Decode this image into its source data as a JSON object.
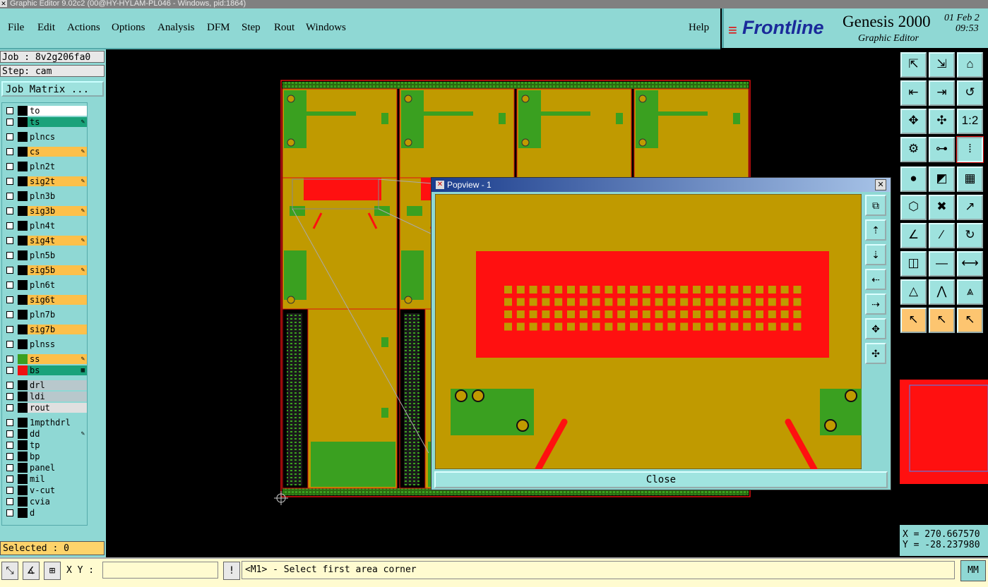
{
  "window_title": "Graphic Editor 9.02c2 (00@HY-HYLAM-PL046 - Windows, pid:1864)",
  "menu": {
    "file": "File",
    "edit": "Edit",
    "actions": "Actions",
    "options": "Options",
    "analysis": "Analysis",
    "dfm": "DFM",
    "step": "Step",
    "rout": "Rout",
    "windows": "Windows",
    "help": "Help"
  },
  "brand": {
    "logo": "Frontline",
    "product": "Genesis 2000",
    "subtitle": "Graphic Editor",
    "date": "01 Feb 2",
    "time": "09:53"
  },
  "job": {
    "job_line": "Job : 8v2g206fa0",
    "step_line": "Step: cam",
    "matrix_button": "Job Matrix ..."
  },
  "layers": [
    {
      "name": "to",
      "color": "#000000",
      "bg": "#ffffff",
      "mark": ""
    },
    {
      "name": "ts",
      "color": "#000000",
      "bg": "#1aa27a",
      "mark": "✎"
    },
    {
      "name": "plncs",
      "color": "#000000",
      "bg": "#8fd8d4",
      "mark": ""
    },
    {
      "name": "cs",
      "color": "#000000",
      "bg": "#fdc04a",
      "mark": "✎"
    },
    {
      "name": "pln2t",
      "color": "#000000",
      "bg": "#8fd8d4",
      "mark": ""
    },
    {
      "name": "sig2t",
      "color": "#000000",
      "bg": "#fdc04a",
      "mark": "✎"
    },
    {
      "name": "pln3b",
      "color": "#000000",
      "bg": "#8fd8d4",
      "mark": ""
    },
    {
      "name": "sig3b",
      "color": "#000000",
      "bg": "#fdc04a",
      "mark": "✎"
    },
    {
      "name": "pln4t",
      "color": "#000000",
      "bg": "#8fd8d4",
      "mark": ""
    },
    {
      "name": "sig4t",
      "color": "#000000",
      "bg": "#fdc04a",
      "mark": "✎"
    },
    {
      "name": "pln5b",
      "color": "#000000",
      "bg": "#8fd8d4",
      "mark": ""
    },
    {
      "name": "sig5b",
      "color": "#000000",
      "bg": "#fdc04a",
      "mark": "✎"
    },
    {
      "name": "pln6t",
      "color": "#000000",
      "bg": "#8fd8d4",
      "mark": ""
    },
    {
      "name": "sig6t",
      "color": "#000000",
      "bg": "#fdc04a",
      "mark": ""
    },
    {
      "name": "pln7b",
      "color": "#000000",
      "bg": "#8fd8d4",
      "mark": ""
    },
    {
      "name": "sig7b",
      "color": "#000000",
      "bg": "#fdc04a",
      "mark": ""
    },
    {
      "name": "plnss",
      "color": "#000000",
      "bg": "#8fd8d4",
      "mark": ""
    },
    {
      "name": "ss",
      "color": "#3aa020",
      "bg": "#fdc04a",
      "mark": "✎"
    },
    {
      "name": "bs",
      "color": "#ee1111",
      "bg": "#1aa27a",
      "mark": "▦"
    },
    {
      "name": "drl",
      "color": "#000000",
      "bg": "#b8c8cc",
      "mark": ""
    },
    {
      "name": "ldi",
      "color": "#000000",
      "bg": "#b8c8cc",
      "mark": ""
    },
    {
      "name": "rout",
      "color": "#000000",
      "bg": "#e0e0e0",
      "mark": ""
    },
    {
      "name": "1mpthdrl",
      "color": "#000000",
      "bg": "#8fd8d4",
      "mark": ""
    },
    {
      "name": "dd",
      "color": "#000000",
      "bg": "#8fd8d4",
      "mark": "✎"
    },
    {
      "name": "tp",
      "color": "#000000",
      "bg": "#8fd8d4",
      "mark": ""
    },
    {
      "name": "bp",
      "color": "#000000",
      "bg": "#8fd8d4",
      "mark": ""
    },
    {
      "name": "panel",
      "color": "#000000",
      "bg": "#8fd8d4",
      "mark": ""
    },
    {
      "name": "mil",
      "color": "#000000",
      "bg": "#8fd8d4",
      "mark": ""
    },
    {
      "name": "v-cut",
      "color": "#000000",
      "bg": "#8fd8d4",
      "mark": ""
    },
    {
      "name": "cvia",
      "color": "#000000",
      "bg": "#8fd8d4",
      "mark": ""
    },
    {
      "name": "d",
      "color": "#000000",
      "bg": "#8fd8d4",
      "mark": ""
    }
  ],
  "selected": "Selected : 0",
  "status": {
    "xy_label": "X Y :",
    "xy_value": "",
    "message": "<M1> - Select first area corner",
    "units": "MM"
  },
  "coords": {
    "x": "X = 270.667570",
    "y": "Y = -28.237980"
  },
  "popview": {
    "title": "Popview - 1",
    "close_label": "Close"
  },
  "toolbar": {
    "rows": [
      [
        "⇱",
        "⇲",
        "⌂"
      ],
      [
        "⇤",
        "⇥",
        "↺"
      ],
      [
        "✥",
        "✣",
        "1:2"
      ],
      [
        "⚙",
        "⊶",
        "⁞"
      ],
      [
        "●",
        "◩",
        "▦"
      ],
      [
        "⬡",
        "✖",
        "↗"
      ],
      [
        "∠",
        "∕",
        "↻"
      ],
      [
        "◫",
        "—",
        "⟷"
      ],
      [
        "△",
        "⋀",
        "⩓"
      ],
      [
        "↖",
        "↖",
        "↖"
      ]
    ]
  },
  "colors": {
    "teal": "#8fd8d4",
    "board": "#c09a00",
    "red": "#ff1010",
    "green": "#3aa020"
  }
}
